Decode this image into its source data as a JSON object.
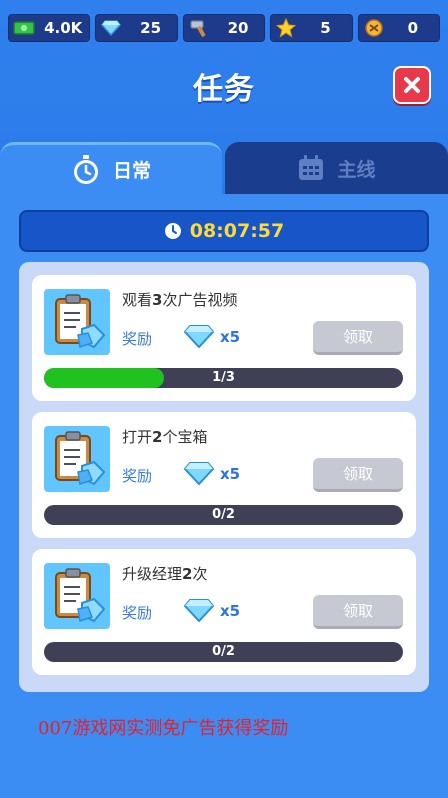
{
  "resources": [
    {
      "icon": "cash-icon",
      "value": "4.0K"
    },
    {
      "icon": "gem-icon",
      "value": "25"
    },
    {
      "icon": "hammer-icon",
      "value": "20"
    },
    {
      "icon": "star-icon",
      "value": "5"
    },
    {
      "icon": "badge-icon",
      "value": "0"
    }
  ],
  "title": "任务",
  "tabs": [
    {
      "label": "日常",
      "icon": "stopwatch-icon",
      "active": true
    },
    {
      "label": "主线",
      "icon": "calendar-icon",
      "active": false
    }
  ],
  "timer": "08:07:57",
  "tasks": [
    {
      "prefix": "观看",
      "count": "3",
      "suffix": "次广告视频",
      "reward_label": "奖励",
      "reward_qty": "x5",
      "claim_label": "领取",
      "progress_text": "1/3",
      "progress": 0.333
    },
    {
      "prefix": "打开",
      "count": "2",
      "suffix": "个宝箱",
      "reward_label": "奖励",
      "reward_qty": "x5",
      "claim_label": "领取",
      "progress_text": "0/2",
      "progress": 0
    },
    {
      "prefix": "升级经理",
      "count": "2",
      "suffix": "次",
      "reward_label": "奖励",
      "reward_qty": "x5",
      "claim_label": "领取",
      "progress_text": "0/2",
      "progress": 0
    }
  ],
  "watermark": "007游戏网实测免广告获得奖励",
  "colors": {
    "accent": "#3b8df4",
    "progress_fill": "#1fc21f",
    "timer_text": "#ffd83a",
    "close_button": "#e8384a"
  }
}
